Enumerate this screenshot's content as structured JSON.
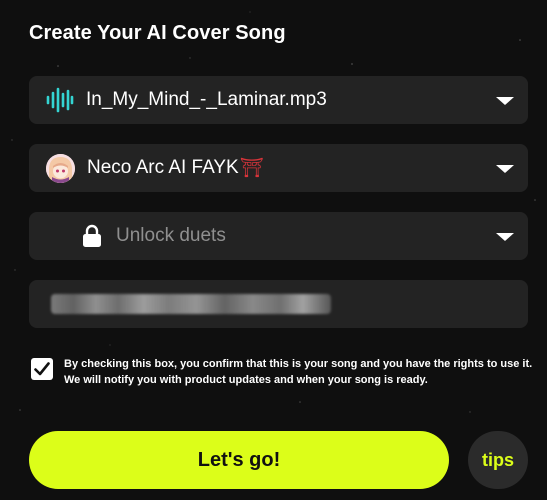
{
  "title": "Create Your AI Cover Song",
  "song_select": {
    "value": "In_My_Mind_-_Laminar.mp3",
    "icon": "waveform-icon"
  },
  "voice_select": {
    "value": "Neco Arc AI FAYK",
    "badge": "⛩",
    "icon": "avatar"
  },
  "duet_select": {
    "placeholder": "Unlock duets",
    "icon": "lock-icon"
  },
  "text_input": {
    "value": ""
  },
  "consent": {
    "checked": true,
    "text": "By checking this box, you confirm that this is your song and you have the rights to use it. We will notify you with product updates and when your song is ready."
  },
  "cta": {
    "label": "Let's go!"
  },
  "tips": {
    "label": "tips"
  },
  "colors": {
    "accent": "#dcfe19",
    "wave": "#34d4d2",
    "background": "#0f0f0f",
    "field": "#232323"
  }
}
